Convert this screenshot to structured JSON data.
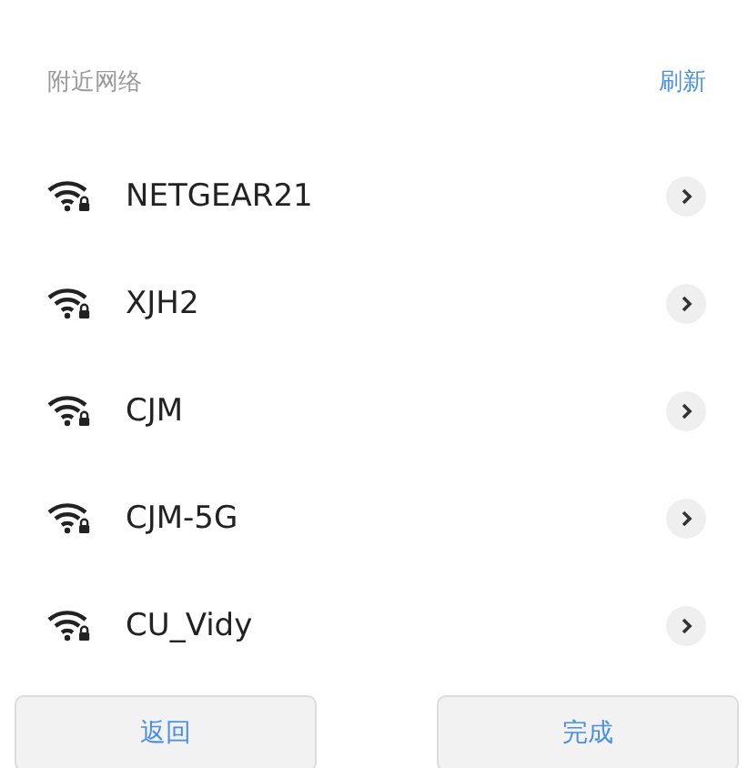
{
  "header": {
    "title": "附近网络",
    "refresh": "刷新"
  },
  "networks": [
    {
      "name": "NETGEAR21"
    },
    {
      "name": "XJH2"
    },
    {
      "name": "CJM"
    },
    {
      "name": "CJM-5G"
    },
    {
      "name": "CU_Vidy"
    }
  ],
  "buttons": [
    {
      "label": "返回"
    },
    {
      "label": "完成"
    }
  ]
}
